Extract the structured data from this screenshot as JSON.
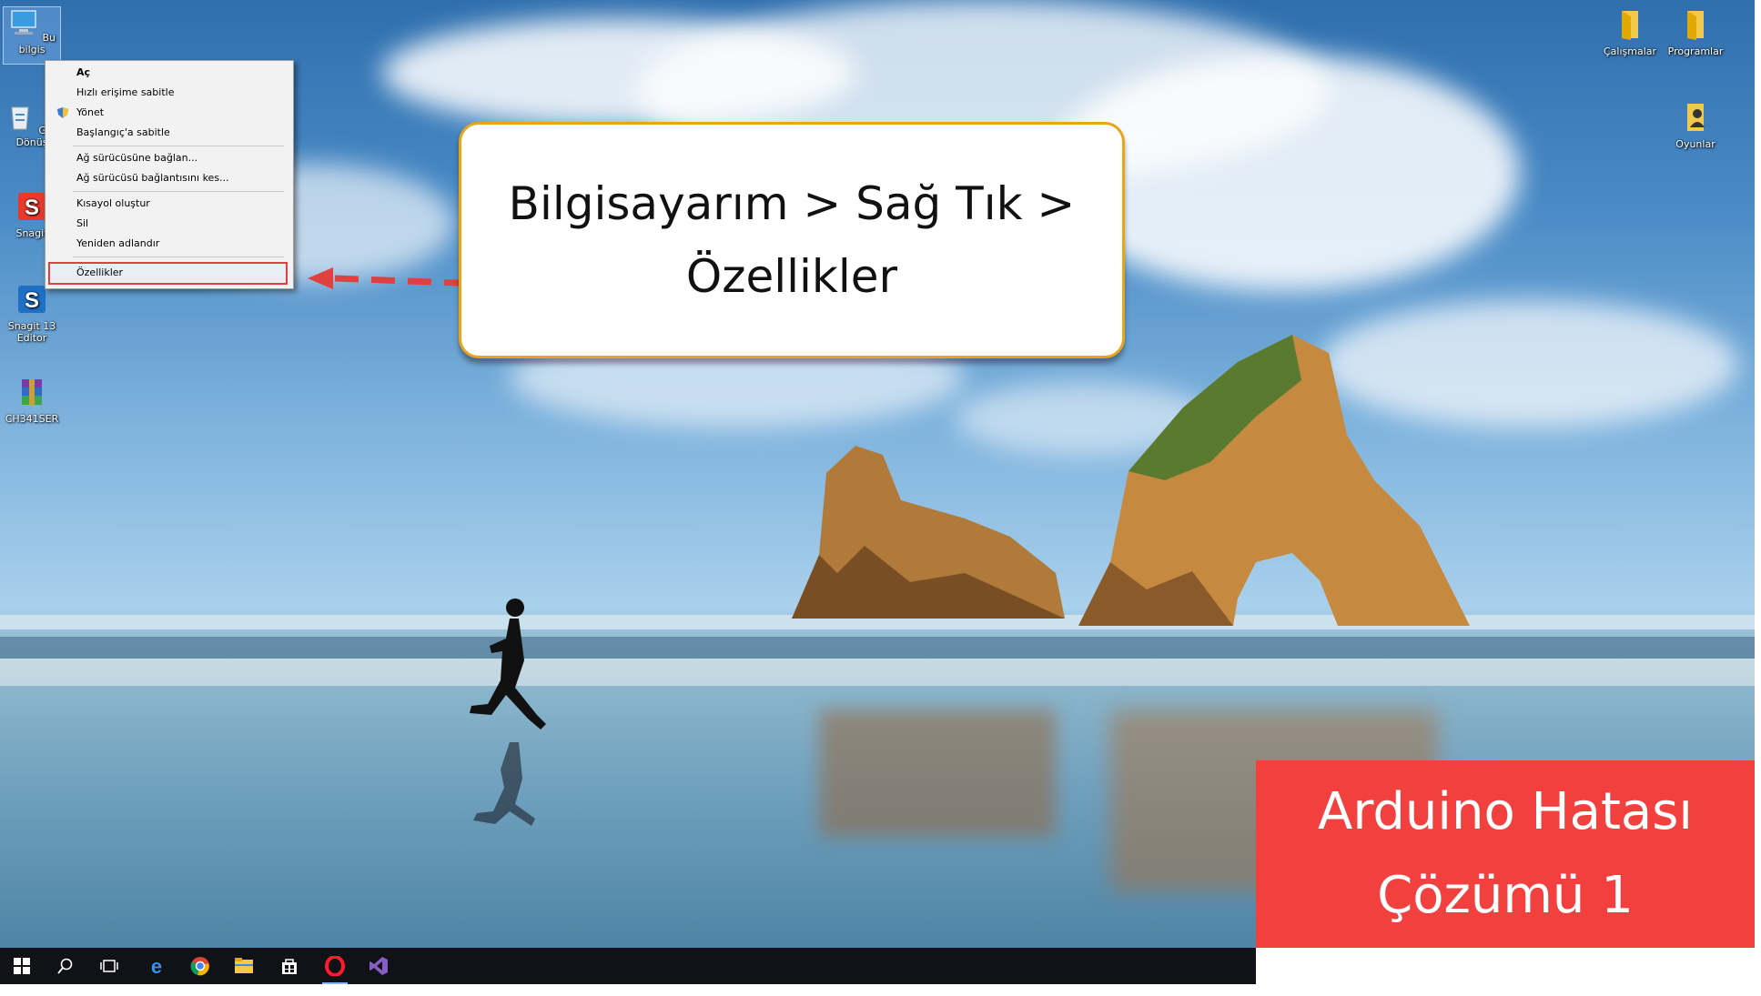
{
  "desktop_icons_left": [
    {
      "label": "Bu bilgis",
      "icon": "computer-icon"
    },
    {
      "label": "Geri Dönüş",
      "icon": "recycle-bin-icon"
    },
    {
      "label": "Snagit",
      "icon": "snagit-icon"
    },
    {
      "label": "Snagit 13 Editor",
      "icon": "snagit-editor-icon"
    },
    {
      "label": "CH341SER",
      "icon": "winrar-archive-icon"
    }
  ],
  "desktop_icons_right": [
    {
      "label": "Çalışmalar",
      "icon": "folder-icon"
    },
    {
      "label": "Programlar",
      "icon": "folder-icon"
    },
    {
      "label": "Oyunlar",
      "icon": "user-folder-icon"
    }
  ],
  "context_menu": {
    "items": [
      {
        "label": "Aç",
        "bold": true
      },
      {
        "label": "Hızlı erişime sabitle"
      },
      {
        "label": "Yönet",
        "icon": "shield-icon"
      },
      {
        "label": "Başlangıç'a sabitle"
      },
      {
        "label": "Ağ sürücüsüne bağlan..."
      },
      {
        "label": "Ağ sürücüsü bağlantısını kes..."
      },
      {
        "label": "Kısayol oluştur"
      },
      {
        "label": "Sil"
      },
      {
        "label": "Yeniden adlandır"
      },
      {
        "label": "Özellikler",
        "highlighted": true
      }
    ]
  },
  "callout": {
    "line1": "Bilgisayarım > Sağ Tık >",
    "line2": "Özellikler"
  },
  "banner": {
    "line1": "Arduino Hatası",
    "line2": "Çözümü 1",
    "color": "#f2403f"
  },
  "taskbar": {
    "items": [
      "start-icon",
      "search-icon",
      "task-view-icon",
      "edge-icon",
      "chrome-icon",
      "file-explorer-icon",
      "store-icon",
      "opera-icon",
      "visual-studio-icon"
    ],
    "active": "opera-icon"
  },
  "colors": {
    "callout_border": "#e8a41a",
    "arrow": "#e0403f",
    "taskbar": "#101217"
  }
}
